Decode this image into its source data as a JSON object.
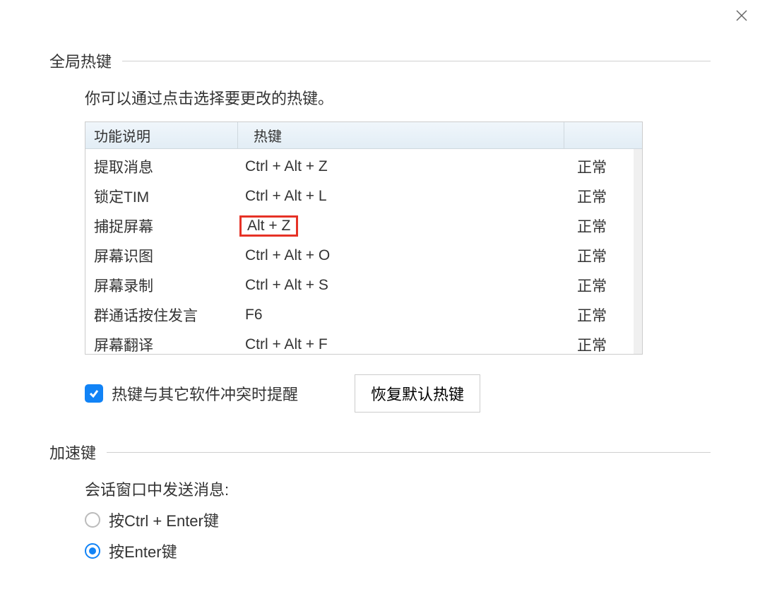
{
  "close_icon": "close",
  "section1": {
    "title": "全局热键",
    "instruction": "你可以通过点击选择要更改的热键。",
    "headers": {
      "col1": "功能说明",
      "col2": "热键"
    },
    "rows": [
      {
        "desc": "提取消息",
        "key": "Ctrl + Alt + Z",
        "status": "正常",
        "highlighted": false
      },
      {
        "desc": "锁定TIM",
        "key": "Ctrl + Alt + L",
        "status": "正常",
        "highlighted": false
      },
      {
        "desc": "捕捉屏幕",
        "key": "Alt + Z",
        "status": "正常",
        "highlighted": true
      },
      {
        "desc": "屏幕识图",
        "key": "Ctrl + Alt + O",
        "status": "正常",
        "highlighted": false
      },
      {
        "desc": "屏幕录制",
        "key": "Ctrl + Alt + S",
        "status": "正常",
        "highlighted": false
      },
      {
        "desc": "群通话按住发言",
        "key": "F6",
        "status": "正常",
        "highlighted": false
      },
      {
        "desc": "屏幕翻译",
        "key": "Ctrl + Alt + F",
        "status": "正常",
        "highlighted": false
      }
    ],
    "conflict_checkbox": "热键与其它软件冲突时提醒",
    "restore_button": "恢复默认热键"
  },
  "section2": {
    "title": "加速键",
    "radio_heading": "会话窗口中发送消息:",
    "radios": [
      {
        "label": "按Ctrl + Enter键",
        "selected": false
      },
      {
        "label": "按Enter键",
        "selected": true
      }
    ]
  }
}
